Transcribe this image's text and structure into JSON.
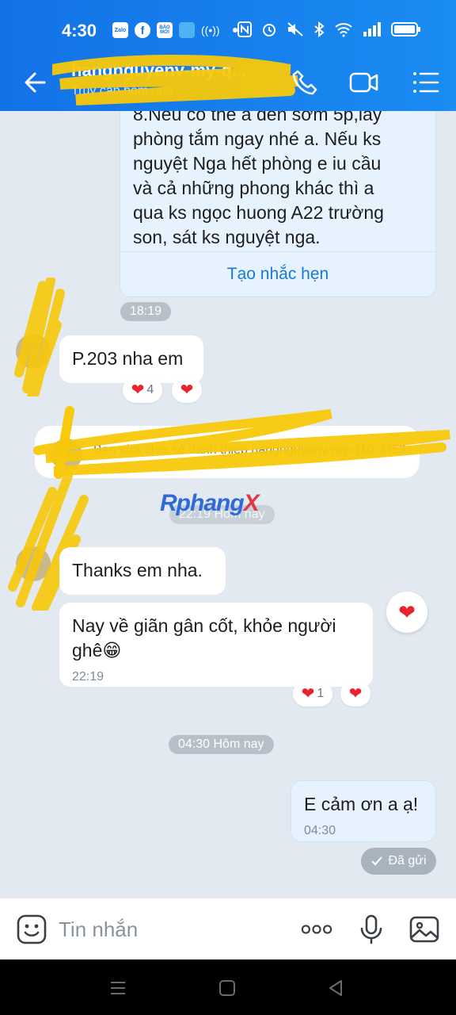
{
  "status_bar": {
    "time": "4:30",
    "notif_icons": [
      "Zalo",
      "f",
      "BÁO MỚI",
      ""
    ],
    "icons": [
      "nfc-icon",
      "alarm-icon",
      "mute-icon",
      "bluetooth-icon",
      "wifi-icon",
      "signal-icon",
      "battery-icon"
    ]
  },
  "header": {
    "contact_name": "hangnguyenv-my-q...",
    "contact_status": "Truy cập hôm qua",
    "accent_color": "#1a7eec"
  },
  "messages": {
    "reminder_card": {
      "text": "8.Nếu có thể a đến sớm 5p,lấy\nphòng tắm ngay nhé a. Nếu ks\nnguyệt Nga hết phòng e iu cầu\nvà cả những phong khác thì  a\nqua ks ngọc huong A22 trường\nson, sát ks nguyệt nga.",
      "button_label": "Tạo nhắc hẹn"
    },
    "time_1819": "18:19",
    "msg_p203": {
      "text": "P.203 nha em",
      "reaction_count": "4"
    },
    "system_notice": "Bạn vừa chia sẻ danh thiếp hangnguyenv-my-q10-2453",
    "system_time": "22:19 Hôm nay",
    "watermark": {
      "part1": "Rphang",
      "part2": "X"
    },
    "msg_thanks": {
      "text": "Thanks em nha."
    },
    "msg_nay": {
      "text": "Nay về giãn gân cốt, khỏe người ghê😁",
      "time": "22:19",
      "reaction_count": "1"
    },
    "time_divider": "04:30 Hôm nay",
    "msg_out": {
      "text": "E cảm ơn a ạ!",
      "time": "04:30"
    },
    "sent_status": "Đã gửi"
  },
  "input_bar": {
    "placeholder": "Tin nhắn"
  }
}
